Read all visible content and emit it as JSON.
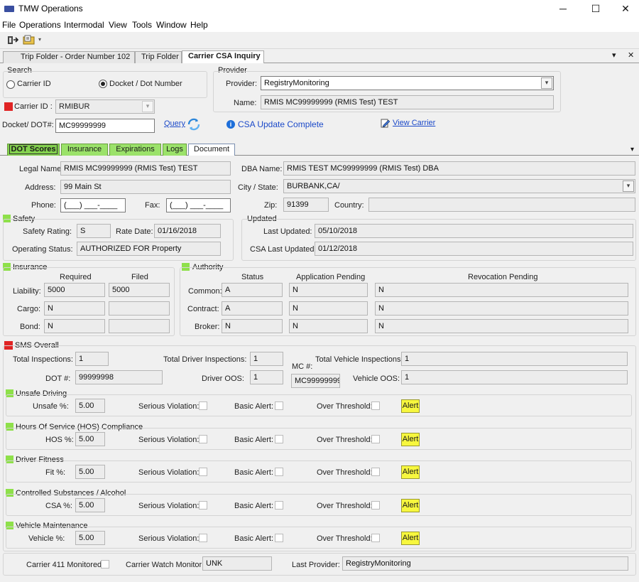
{
  "window": {
    "title": "TMW Operations",
    "minimize": "─",
    "maximize": "☐",
    "close": "✕"
  },
  "menu": [
    "File",
    "Operations",
    "Intermodal",
    "View",
    "Tools",
    "Window",
    "Help"
  ],
  "doc_tabs": [
    {
      "label": "Trip Folder - Order Number 102"
    },
    {
      "label": "Trip Folder"
    },
    {
      "label": "Carrier CSA Inquiry"
    }
  ],
  "doc_tab_controls": {
    "dropdown": "▾",
    "close": "✕"
  },
  "search": {
    "group_label": "Search",
    "radio_carrier_id": "Carrier ID",
    "radio_docket": "Docket / Dot Number",
    "carrier_id_label": "Carrier ID :",
    "carrier_id_value": "RMIBUR",
    "docket_label": "Docket/ DOT#:",
    "docket_value": "MC99999999",
    "query_link": "Query"
  },
  "provider": {
    "group_label": "Provider",
    "provider_label": "Provider:",
    "provider_value": "RegistryMonitoring",
    "name_label": "Name:",
    "name_value": "RMIS MC99999999 (RMIS Test) TEST",
    "status": "CSA Update Complete",
    "view_carrier": "View Carrier"
  },
  "sub_tabs": [
    "DOT Scores",
    "Insurance",
    "Expirations",
    "Logs",
    "Document"
  ],
  "carrier": {
    "legal_name_label": "Legal Name:",
    "legal_name": "RMIS MC99999999 (RMIS Test) TEST",
    "dba_name_label": "DBA Name:",
    "dba_name": "RMIS TEST MC99999999 (RMIS Test) DBA",
    "address_label": "Address:",
    "address": "99 Main St",
    "city_state_label": "City / State:",
    "city_state": "BURBANK,CA/",
    "phone_label": "Phone:",
    "phone": "(___) ___-____",
    "fax_label": "Fax:",
    "fax": "(___) ___-____",
    "zip_label": "Zip:",
    "zip": "91399",
    "country_label": "Country:",
    "country": ""
  },
  "safety": {
    "title": "Safety",
    "rating_label": "Safety Rating:",
    "rating": "S",
    "rate_date_label": "Rate Date:",
    "rate_date": "01/16/2018",
    "op_status_label": "Operating Status:",
    "op_status": "AUTHORIZED FOR Property"
  },
  "updated": {
    "title": "Updated",
    "last_updated_label": "Last Updated:",
    "last_updated": "05/10/2018",
    "csa_last_label": "CSA Last Updated:",
    "csa_last": "01/12/2018"
  },
  "insurance": {
    "title": "Insurance",
    "col_required": "Required",
    "col_filed": "Filed",
    "rows": [
      {
        "label": "Liability:",
        "required": "5000",
        "filed": "5000"
      },
      {
        "label": "Cargo:",
        "required": "N",
        "filed": ""
      },
      {
        "label": "Bond:",
        "required": "N",
        "filed": ""
      }
    ]
  },
  "authority": {
    "title": "Authority",
    "col_status": "Status",
    "col_app": "Application Pending",
    "col_rev": "Revocation Pending",
    "rows": [
      {
        "label": "Common:",
        "status": "A",
        "app": "N",
        "rev": "N"
      },
      {
        "label": "Contract:",
        "status": "A",
        "app": "N",
        "rev": "N"
      },
      {
        "label": "Broker:",
        "status": "N",
        "app": "N",
        "rev": "N"
      }
    ]
  },
  "sms": {
    "title": "SMS Overall",
    "total_insp_label": "Total Inspections:",
    "total_insp": "1",
    "total_driver_label": "Total Driver Inspections:",
    "total_driver": "1",
    "total_vehicle_label": "Total Vehicle Inspections:",
    "total_vehicle": "1",
    "dot_label": "DOT #:",
    "dot": "99999998",
    "driver_oos_label": "Driver OOS:",
    "driver_oos": "1",
    "mc_label": "MC #:",
    "mc": "MC99999999",
    "vehicle_oos_label": "Vehicle OOS:",
    "vehicle_oos": "1"
  },
  "basics_common": {
    "serious": "Serious Violation:",
    "basic_alert": "Basic Alert:",
    "over_threshold": "Over Threshold:",
    "alert": "Alert"
  },
  "basics": [
    {
      "title": "Unsafe Driving",
      "label": "Unsafe %:",
      "value": "5.00"
    },
    {
      "title": "Hours Of Service (HOS) Compliance",
      "label": "HOS %:",
      "value": "5.00"
    },
    {
      "title": "Driver Fitness",
      "label": "Fit %:",
      "value": "5.00"
    },
    {
      "title": "Controlled Substances / Alcohol",
      "label": "CSA %:",
      "value": "5.00"
    },
    {
      "title": "Vehicle Maintenance",
      "label": "Vehicle %:",
      "value": "5.00"
    }
  ],
  "footer": {
    "c411_label": "Carrier 411 Monitored:",
    "watch_label": "Carrier Watch Monitor:",
    "watch_value": "UNK",
    "last_provider_label": "Last Provider:",
    "last_provider": "RegistryMonitoring"
  },
  "colors": {
    "alert_yellow": "#f7f73e",
    "indicator_green": "#8ee04a",
    "indicator_red": "#e02424",
    "link_blue": "#1b49c9"
  }
}
